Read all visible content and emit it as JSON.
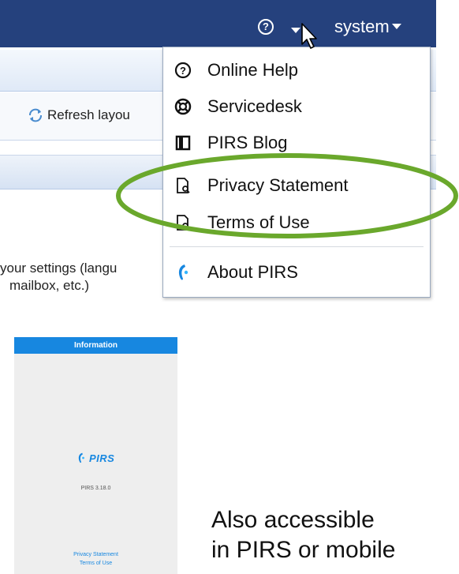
{
  "header": {
    "help_icon": "?",
    "user_label": "system"
  },
  "toolbar": {
    "refresh_label": "Refresh layou"
  },
  "settings_text": {
    "line1": "your settings (langu",
    "line2": "mailbox, etc.)"
  },
  "help_menu": {
    "items": [
      {
        "label": "Online Help",
        "icon": "question-circle-icon"
      },
      {
        "label": "Servicedesk",
        "icon": "lifebuoy-icon"
      },
      {
        "label": "PIRS Blog",
        "icon": "book-icon"
      },
      {
        "label": "Privacy Statement",
        "icon": "document-search-icon"
      },
      {
        "label": "Terms of Use",
        "icon": "document-search-icon"
      },
      {
        "label": "About PIRS",
        "icon": "pirs-logo-icon"
      }
    ]
  },
  "highlight_color": "#6aa82c",
  "info_screen": {
    "title": "Information",
    "logo_text": "PIRS",
    "version": "PIRS 3.18.0",
    "links": [
      "Privacy Statement",
      "Terms of Use"
    ]
  },
  "caption": {
    "line1": "Also accessible",
    "line2": "in PIRS or mobile"
  }
}
